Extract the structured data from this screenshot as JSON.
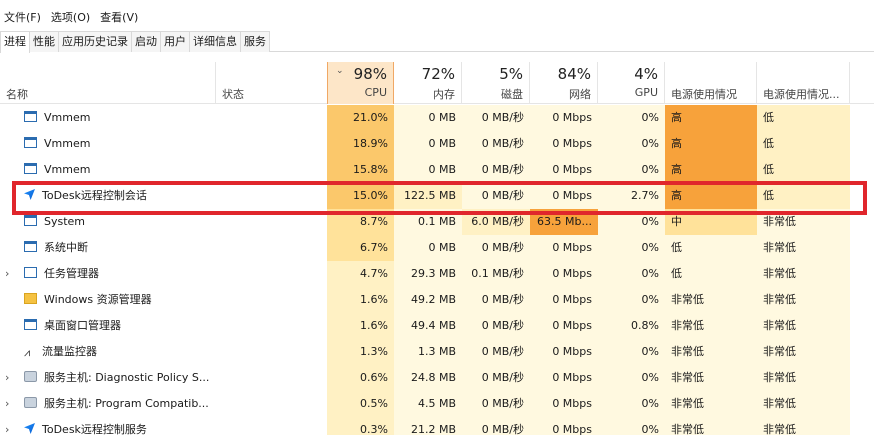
{
  "menu": [
    "文件(F)",
    "选项(O)",
    "查看(V)"
  ],
  "tabs": [
    {
      "label": "进程",
      "active": true
    },
    {
      "label": "性能",
      "active": false
    },
    {
      "label": "应用历史记录",
      "active": false
    },
    {
      "label": "启动",
      "active": false
    },
    {
      "label": "用户",
      "active": false
    },
    {
      "label": "详细信息",
      "active": false
    },
    {
      "label": "服务",
      "active": false
    }
  ],
  "header": {
    "name": "名称",
    "status": "状态",
    "cpu": {
      "pct": "98%",
      "label": "CPU"
    },
    "memory": {
      "pct": "72%",
      "label": "内存"
    },
    "disk": {
      "pct": "5%",
      "label": "磁盘"
    },
    "network": {
      "pct": "84%",
      "label": "网络"
    },
    "gpu": {
      "pct": "4%",
      "label": "GPU"
    },
    "power": "电源使用情况",
    "power_trend": "电源使用情况..."
  },
  "colors": {
    "heat_lightest": "#fff9e0",
    "heat_light": "#fff1c4",
    "heat_mid": "#ffe29a",
    "heat_strong": "#fbc86b",
    "heat_max": "#f7a23b",
    "highlight_border": "#e0262c"
  },
  "rows": [
    {
      "icon": "window-icon",
      "name": "Vmmem",
      "expandable": false,
      "cpu": "21.0%",
      "mem": "0 MB",
      "disk": "0 MB/秒",
      "net": "0 Mbps",
      "gpu": "0%",
      "power": "高",
      "trend": "低"
    },
    {
      "icon": "window-icon",
      "name": "Vmmem",
      "expandable": false,
      "cpu": "18.9%",
      "mem": "0 MB",
      "disk": "0 MB/秒",
      "net": "0 Mbps",
      "gpu": "0%",
      "power": "高",
      "trend": "低"
    },
    {
      "icon": "window-icon",
      "name": "Vmmem",
      "expandable": false,
      "cpu": "15.8%",
      "mem": "0 MB",
      "disk": "0 MB/秒",
      "net": "0 Mbps",
      "gpu": "0%",
      "power": "高",
      "trend": "低"
    },
    {
      "icon": "todesk-icon",
      "name": "ToDesk远程控制会话",
      "expandable": false,
      "cpu": "15.0%",
      "mem": "122.5 MB",
      "disk": "0 MB/秒",
      "net": "0 Mbps",
      "gpu": "2.7%",
      "power": "高",
      "trend": "低"
    },
    {
      "icon": "window-icon",
      "name": "System",
      "expandable": false,
      "cpu": "8.7%",
      "mem": "0.1 MB",
      "disk": "6.0 MB/秒",
      "net": "63.5 Mb...",
      "gpu": "0%",
      "power": "中",
      "trend": "非常低"
    },
    {
      "icon": "window-icon",
      "name": "系统中断",
      "expandable": false,
      "cpu": "6.7%",
      "mem": "0 MB",
      "disk": "0 MB/秒",
      "net": "0 Mbps",
      "gpu": "0%",
      "power": "低",
      "trend": "非常低"
    },
    {
      "icon": "chart-icon",
      "name": "任务管理器",
      "expandable": true,
      "cpu": "4.7%",
      "mem": "29.3 MB",
      "disk": "0.1 MB/秒",
      "net": "0 Mbps",
      "gpu": "0%",
      "power": "低",
      "trend": "非常低"
    },
    {
      "icon": "folder-icon",
      "name": "Windows 资源管理器",
      "expandable": false,
      "cpu": "1.6%",
      "mem": "49.2 MB",
      "disk": "0 MB/秒",
      "net": "0 Mbps",
      "gpu": "0%",
      "power": "非常低",
      "trend": "非常低"
    },
    {
      "icon": "window-icon",
      "name": "桌面窗口管理器",
      "expandable": false,
      "cpu": "1.6%",
      "mem": "49.4 MB",
      "disk": "0 MB/秒",
      "net": "0 Mbps",
      "gpu": "0.8%",
      "power": "非常低",
      "trend": "非常低"
    },
    {
      "icon": "traffic-icon",
      "name": "流量监控器",
      "expandable": false,
      "cpu": "1.3%",
      "mem": "1.3 MB",
      "disk": "0 MB/秒",
      "net": "0 Mbps",
      "gpu": "0%",
      "power": "非常低",
      "trend": "非常低"
    },
    {
      "icon": "gear-icon",
      "name": "服务主机: Diagnostic Policy S...",
      "expandable": true,
      "cpu": "0.6%",
      "mem": "24.8 MB",
      "disk": "0 MB/秒",
      "net": "0 Mbps",
      "gpu": "0%",
      "power": "非常低",
      "trend": "非常低"
    },
    {
      "icon": "gear-icon",
      "name": "服务主机: Program Compatib...",
      "expandable": true,
      "cpu": "0.5%",
      "mem": "4.5 MB",
      "disk": "0 MB/秒",
      "net": "0 Mbps",
      "gpu": "0%",
      "power": "非常低",
      "trend": "非常低"
    },
    {
      "icon": "todesk-icon",
      "name": "ToDesk远程控制服务",
      "expandable": true,
      "cpu": "0.3%",
      "mem": "21.2 MB",
      "disk": "0 MB/秒",
      "net": "0 Mbps",
      "gpu": "0%",
      "power": "非常低",
      "trend": "非常低"
    }
  ]
}
